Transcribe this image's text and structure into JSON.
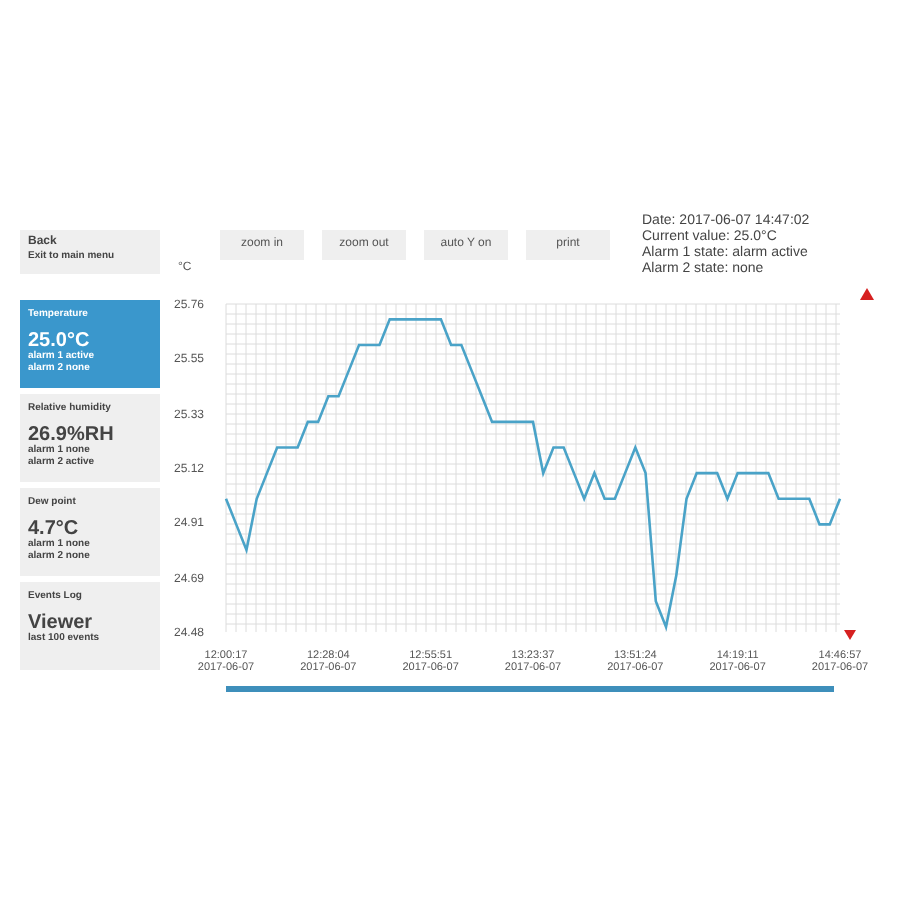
{
  "sidebar": {
    "items": [
      {
        "kind": "back",
        "title": "Back",
        "subtitle": "Exit to main menu",
        "selected": false
      },
      {
        "kind": "sensor",
        "title": "Temperature",
        "value": "25.0°C",
        "lines": [
          "alarm 1 active",
          "alarm 2 none"
        ],
        "selected": true
      },
      {
        "kind": "sensor",
        "title": "Relative humidity",
        "value": "26.9%RH",
        "lines": [
          "alarm 1 none",
          "alarm 2 active"
        ],
        "selected": false
      },
      {
        "kind": "sensor",
        "title": "Dew point",
        "value": "4.7°C",
        "lines": [
          "alarm 1 none",
          "alarm 2 none"
        ],
        "selected": false
      },
      {
        "kind": "sensor",
        "title": "Events Log",
        "value": "Viewer",
        "lines": [
          "last 100 events"
        ],
        "selected": false
      }
    ]
  },
  "toolbar": {
    "buttons": [
      "zoom in",
      "zoom out",
      "auto Y on",
      "print"
    ]
  },
  "info": [
    "Date: 2017-06-07 14:47:02",
    "Current value: 25.0°C",
    "Alarm 1 state: alarm active",
    "Alarm 2 state: none"
  ],
  "chart": {
    "chart_data": {
      "type": "line",
      "grid": true,
      "ylabel": "°C",
      "ylim": [
        24.48,
        25.76
      ],
      "yticks": [
        {
          "value": 25.76,
          "label": "25.76"
        },
        {
          "value": 25.55,
          "label": "25.55"
        },
        {
          "value": 25.33,
          "label": "25.33"
        },
        {
          "value": 25.12,
          "label": "25.12"
        },
        {
          "value": 24.91,
          "label": "24.91"
        },
        {
          "value": 24.69,
          "label": "24.69"
        },
        {
          "value": 24.48,
          "label": "24.48"
        }
      ],
      "categories": [
        "12:00:17\n2017-06-07",
        null,
        null,
        null,
        null,
        null,
        null,
        null,
        null,
        null,
        "12:28:04\n2017-06-07",
        null,
        null,
        null,
        null,
        null,
        null,
        null,
        null,
        null,
        "12:55:51\n2017-06-07",
        null,
        null,
        null,
        null,
        null,
        null,
        null,
        null,
        null,
        "13:23:37\n2017-06-07",
        null,
        null,
        null,
        null,
        null,
        null,
        null,
        null,
        null,
        "13:51:24\n2017-06-07",
        null,
        null,
        null,
        null,
        null,
        null,
        null,
        null,
        null,
        "14:19:11\n2017-06-07",
        null,
        null,
        null,
        null,
        null,
        null,
        null,
        null,
        null,
        "14:46:57\n2017-06-07"
      ],
      "series": [
        {
          "color": "#4aa3c8",
          "values": [
            25.0,
            24.9,
            24.8,
            25.0,
            25.1,
            25.2,
            25.2,
            25.2,
            25.3,
            25.3,
            25.4,
            25.4,
            25.5,
            25.6,
            25.6,
            25.6,
            25.7,
            25.7,
            25.7,
            25.7,
            25.7,
            25.7,
            25.6,
            25.6,
            25.5,
            25.4,
            25.3,
            25.3,
            25.3,
            25.3,
            25.3,
            25.1,
            25.2,
            25.2,
            25.1,
            25.0,
            25.1,
            25.0,
            25.0,
            25.1,
            25.2,
            25.1,
            24.6,
            24.5,
            24.7,
            25.0,
            25.1,
            25.1,
            25.1,
            25.0,
            25.1,
            25.1,
            25.1,
            25.1,
            25.0,
            25.0,
            25.0,
            25.0,
            24.9,
            24.9,
            25.0
          ]
        }
      ]
    }
  }
}
